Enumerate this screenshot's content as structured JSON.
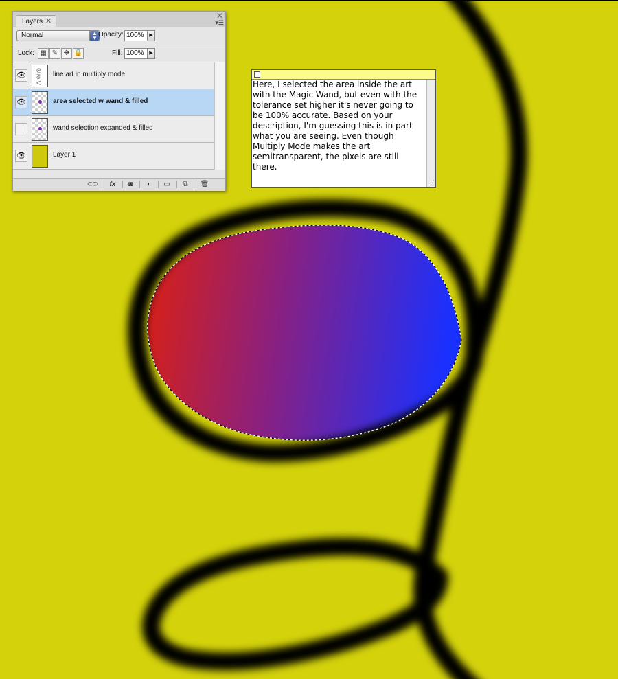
{
  "layers_panel": {
    "tab_label": "Layers",
    "blend_mode": "Normal",
    "opacity_label": "Opacity:",
    "opacity_value": "100%",
    "lock_label": "Lock:",
    "fill_label": "Fill:",
    "fill_value": "100%",
    "layers": [
      {
        "name": "line art in multiply mode",
        "visible": true,
        "selected": false
      },
      {
        "name": "area selected w wand & filled",
        "visible": true,
        "selected": true
      },
      {
        "name": "wand selection expanded & filled",
        "visible": false,
        "selected": false
      },
      {
        "name": "Layer 1",
        "visible": true,
        "selected": false
      }
    ],
    "bottom_icons": [
      "link-icon",
      "fx-icon",
      "mask-icon",
      "adjustment-icon",
      "folder-icon",
      "new-layer-icon",
      "trash-icon"
    ]
  },
  "note": {
    "text": "Here, I selected the area inside the art with the Magic Wand, but even with the tolerance set higher it's never going to be 100% accurate. Based on your description, I'm guessing this is in part what you are seeing. Even though Multiply Mode makes the art semitransparent, the pixels are still there."
  },
  "colors": {
    "canvas_background": "#d4d20a",
    "gradient_start": "#dc2010",
    "gradient_end": "#1a30ff",
    "line_art": "#000000",
    "note_bar": "#fdfb8d",
    "selected_layer": "#b8d7f5"
  }
}
